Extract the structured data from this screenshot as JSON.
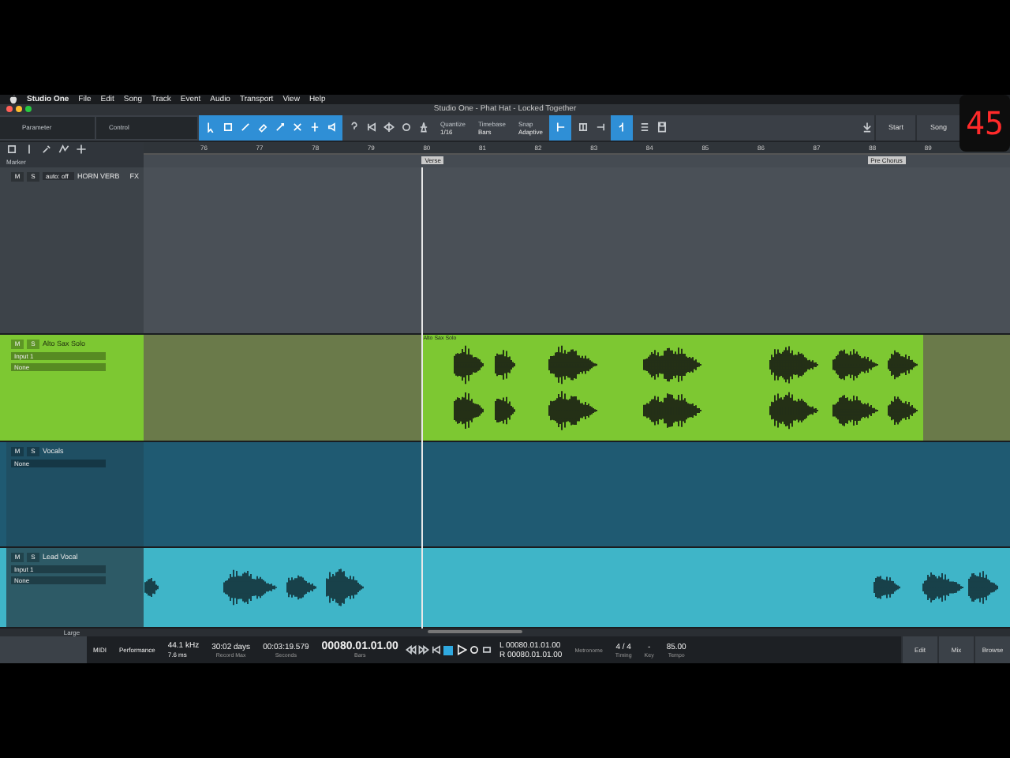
{
  "menu_bar": {
    "app": "Studio One",
    "items": [
      "File",
      "Edit",
      "Song",
      "Track",
      "Event",
      "Audio",
      "Transport",
      "View",
      "Help"
    ]
  },
  "window": {
    "title": "Studio One - Phat Hat - Locked Together"
  },
  "toolbar": {
    "parameter": {
      "label": "Parameter"
    },
    "control": {
      "label": "Control"
    },
    "quantize": {
      "label": "Quantize",
      "value": "1/16"
    },
    "timebase": {
      "label": "Timebase",
      "value": "Bars"
    },
    "snap": {
      "label": "Snap",
      "value": "Adaptive"
    },
    "buttons": [
      "Start",
      "Song"
    ]
  },
  "counter_badge": "45",
  "ruler": {
    "bars": [
      "76",
      "77",
      "78",
      "79",
      "80",
      "81",
      "82",
      "83",
      "84",
      "85",
      "86",
      "87",
      "88",
      "89"
    ]
  },
  "markers": {
    "label": "Marker",
    "items": [
      "Verse",
      "Pre Chorus"
    ]
  },
  "tracks": [
    {
      "kind": "fx",
      "name": "HORN VERB",
      "label": "FX",
      "buttons": [
        "M",
        "S"
      ],
      "send": "auto: off",
      "color": "#3d4349"
    },
    {
      "kind": "audio",
      "name": "Alto Sax Solo",
      "buttons": [
        "M",
        "S"
      ],
      "input": "Input 1",
      "output": "None",
      "color": "#7dc832",
      "clip": {
        "name": "Alto Sax Solo"
      }
    },
    {
      "kind": "folder",
      "name": "Vocals",
      "buttons": [
        "M",
        "S"
      ],
      "output": "None",
      "color": "#1f5a72"
    },
    {
      "kind": "audio",
      "name": "Lead Vocal",
      "buttons": [
        "M",
        "S"
      ],
      "input": "Input 1",
      "output": "None",
      "color": "#3fb5c8"
    }
  ],
  "lane_footer": {
    "size": "Large"
  },
  "transport": {
    "midi": "MIDI",
    "performance": "Performance",
    "sample_rate": "44.1 kHz",
    "latency": "7.6 ms",
    "record_max": {
      "value": "30:02 days",
      "label": "Record Max"
    },
    "seconds": {
      "value": "00:03:19.579",
      "label": "Seconds"
    },
    "bars": {
      "value": "00080.01.01.00",
      "label": "Bars"
    },
    "loop_left": {
      "tag": "L",
      "value": "00080.01.01.00"
    },
    "loop_right": {
      "tag": "R",
      "value": "00080.01.01.00"
    },
    "metronome": "Metronome",
    "timing": {
      "value": "4 / 4",
      "label": "Timing"
    },
    "key": {
      "value": "-",
      "label": "Key"
    },
    "tempo": {
      "value": "85.00",
      "label": "Tempo"
    },
    "views": [
      "Edit",
      "Mix",
      "Browse"
    ]
  }
}
